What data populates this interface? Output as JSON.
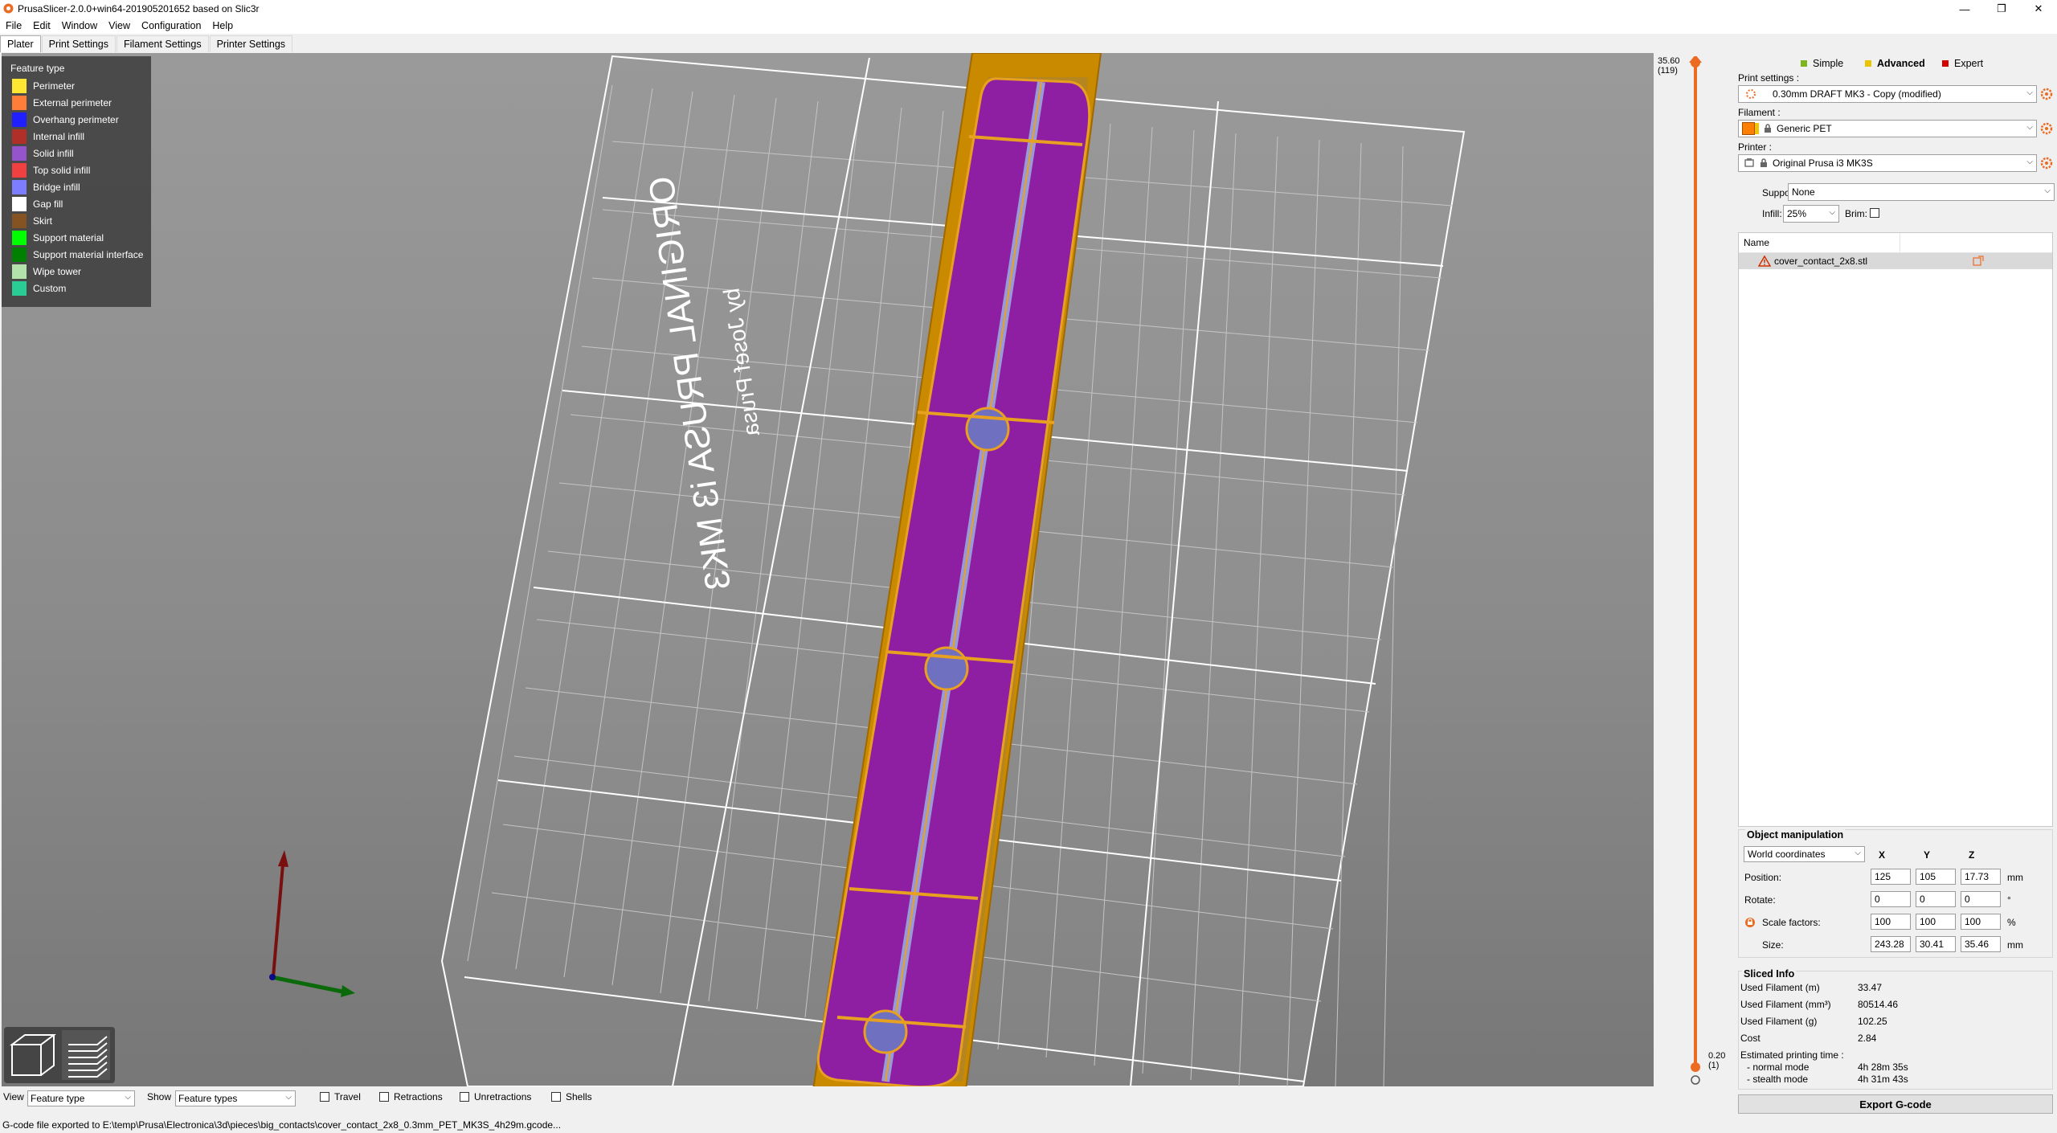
{
  "window": {
    "title": "PrusaSlicer-2.0.0+win64-201905201652 based on Slic3r",
    "minimize": "—",
    "maximize": "❐",
    "close": "✕"
  },
  "menu": [
    "File",
    "Edit",
    "Window",
    "View",
    "Configuration",
    "Help"
  ],
  "tabs": [
    "Plater",
    "Print Settings",
    "Filament Settings",
    "Printer Settings"
  ],
  "legend": {
    "title": "Feature type",
    "items": [
      {
        "label": "Perimeter",
        "color": "#FFE632"
      },
      {
        "label": "External perimeter",
        "color": "#FF7D38"
      },
      {
        "label": "Overhang perimeter",
        "color": "#1F1FFF"
      },
      {
        "label": "Internal infill",
        "color": "#B03029"
      },
      {
        "label": "Solid infill",
        "color": "#9654CC"
      },
      {
        "label": "Top solid infill",
        "color": "#F04040"
      },
      {
        "label": "Bridge infill",
        "color": "#7D7DFF"
      },
      {
        "label": "Gap fill",
        "color": "#FFFFFF"
      },
      {
        "label": "Skirt",
        "color": "#845321"
      },
      {
        "label": "Support material",
        "color": "#00FF00"
      },
      {
        "label": "Support material interface",
        "color": "#008000"
      },
      {
        "label": "Wipe tower",
        "color": "#B3E3AB"
      },
      {
        "label": "Custom",
        "color": "#28CC94"
      }
    ]
  },
  "bed_text": {
    "line1": "ORIGINAL PRUSA i3 MK3",
    "line2": "by Josef Prusa"
  },
  "layer_slider": {
    "top_value": "35.60",
    "top_layer": "(119)",
    "bottom_value": "0.20",
    "bottom_layer": "(1)"
  },
  "modes": [
    {
      "label": "Simple",
      "color": "#7DB51F"
    },
    {
      "label": "Advanced",
      "color": "#EAC400"
    },
    {
      "label": "Expert",
      "color": "#D40000"
    }
  ],
  "presets": {
    "print_label": "Print settings :",
    "print_value": "0.30mm DRAFT MK3 - Copy (modified)",
    "filament_label": "Filament :",
    "filament_value": "Generic PET",
    "filament_color": "#FF8000",
    "printer_label": "Printer :",
    "printer_value": "Original Prusa i3 MK3S",
    "supports_label": "Supports:",
    "supports_value": "None",
    "infill_label": "Infill:",
    "infill_value": "25%",
    "brim_label": "Brim:"
  },
  "object_list": {
    "header_name": "Name",
    "objects": [
      "cover_contact_2x8.stl"
    ]
  },
  "object_manipulation": {
    "title": "Object manipulation",
    "coord_system": "World coordinates",
    "axes": [
      "X",
      "Y",
      "Z"
    ],
    "position_label": "Position:",
    "position": [
      "125",
      "105",
      "17.73"
    ],
    "position_unit": "mm",
    "rotate_label": "Rotate:",
    "rotate": [
      "0",
      "0",
      "0"
    ],
    "rotate_unit": "°",
    "scale_label": "Scale factors:",
    "scale": [
      "100",
      "100",
      "100"
    ],
    "scale_unit": "%",
    "size_label": "Size:",
    "size": [
      "243.28",
      "30.41",
      "35.46"
    ],
    "size_unit": "mm"
  },
  "sliced_info": {
    "title": "Sliced Info",
    "rows": [
      {
        "label": "Used Filament (m)",
        "value": "33.47"
      },
      {
        "label": "Used Filament (mm³)",
        "value": "80514.46"
      },
      {
        "label": "Used Filament (g)",
        "value": "102.25"
      },
      {
        "label": "Cost",
        "value": "2.84"
      },
      {
        "label": "Estimated printing time :",
        "value": ""
      },
      {
        "label": "- normal mode",
        "value": "4h 28m 35s"
      },
      {
        "label": "- stealth mode",
        "value": "4h 31m 43s"
      }
    ]
  },
  "export_button": "Export G-code",
  "bottom_bar": {
    "view_label": "View",
    "view_value": "Feature type",
    "show_label": "Show",
    "show_value": "Feature types",
    "travel": "Travel",
    "retractions": "Retractions",
    "unretractions": "Unretractions",
    "shells": "Shells"
  },
  "status": "G-code file exported to E:\\temp\\Prusa\\Electronica\\3d\\pieces\\big_contacts\\cover_contact_2x8_0.3mm_PET_MK3S_4h29m.gcode..."
}
